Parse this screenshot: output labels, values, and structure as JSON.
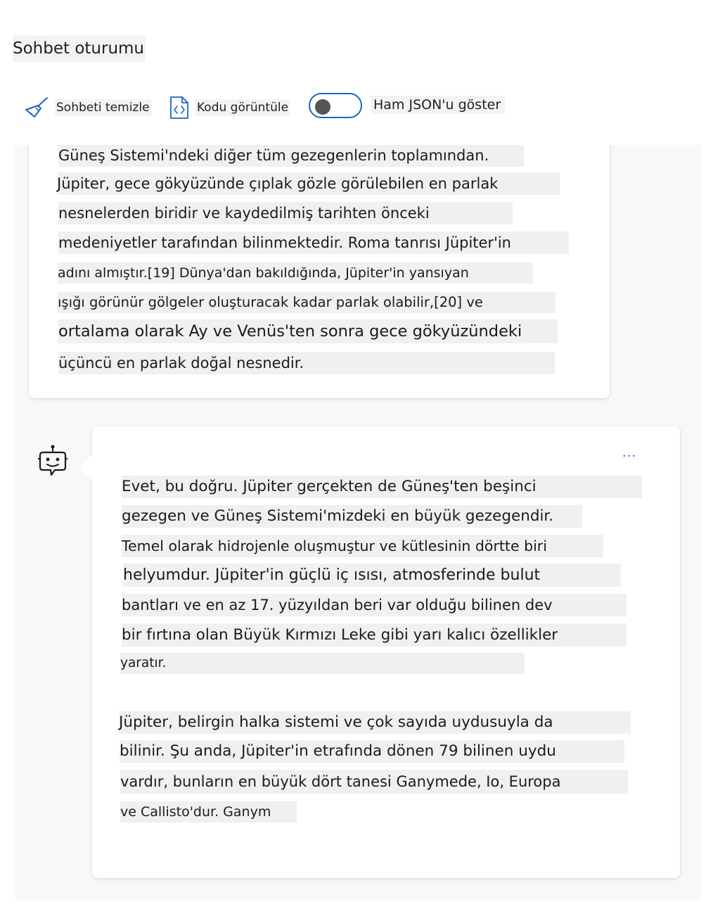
{
  "header": {
    "title": "Sohbet oturumu"
  },
  "toolbar": {
    "clear_label": "Sohbeti temizle",
    "view_code_label": "Kodu görüntüle",
    "show_json_label": "Ham JSON'u göster",
    "show_json_on": false,
    "icons": {
      "clear": "broom-icon",
      "view_code": "code-file-icon"
    }
  },
  "messages": [
    {
      "role": "user",
      "lines": [
        "Güneş Sistemi'ndeki diğer tüm gezegenlerin toplamından.",
        "Jüpiter, gece gökyüzünde çıplak gözle görülebilen en parlak",
        "nesnelerden biridir ve kaydedilmiş tarihten önceki",
        "medeniyetler tarafından bilinmektedir. Roma tanrısı Jüpiter'in",
        "adını almıştır.[19] Dünya'dan bakıldığında, Jüpiter'in yansıyan",
        "ışığı görünür gölgeler oluşturacak kadar parlak olabilir,[20] ve",
        "ortalama olarak Ay ve Venüs'ten sonra gece gökyüzündeki",
        "üçüncü en parlak doğal nesnedir."
      ]
    },
    {
      "role": "assistant",
      "avatar_icon": "bot-icon",
      "more_label": "...",
      "lines": [
        "Evet, bu doğru. Jüpiter gerçekten de Güneş'ten beşinci",
        "gezegen ve Güneş Sistemi'mizdeki en büyük gezegendir.",
        "Temel olarak hidrojenle oluşmuştur ve kütlesinin dörtte biri",
        "helyumdur. Jüpiter'in güçlü iç ısısı, atmosferinde bulut",
        "bantları ve en az 17. yüzyıldan beri var olduğu bilinen dev",
        "bir fırtına olan Büyük Kırmızı Leke gibi yarı kalıcı özellikler",
        "yaratır.",
        "Jüpiter, belirgin halka sistemi ve çok sayıda uydusuyla da",
        "bilinir. Şu anda, Jüpiter'in etrafında dönen 79 bilinen uydu",
        "vardır, bunların en büyük dört tanesi Ganymede, Io, Europa",
        "ve Callisto'dur. Ganym"
      ]
    }
  ],
  "colors": {
    "accent": "#1a66c4",
    "chat_background": "#f8f8f8",
    "text_highlight": "#f0f0f0"
  }
}
